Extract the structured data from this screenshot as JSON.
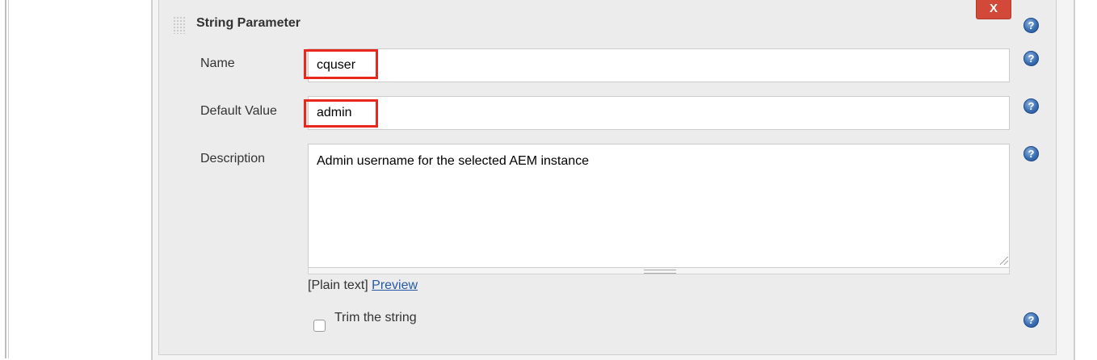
{
  "section": {
    "title": "String Parameter",
    "delete_label": "X",
    "help_glyph": "?"
  },
  "fields": {
    "name": {
      "label": "Name",
      "value": "cquser"
    },
    "default_value": {
      "label": "Default Value",
      "value": "admin"
    },
    "description": {
      "label": "Description",
      "value": "Admin username for the selected AEM instance"
    }
  },
  "format": {
    "plain_text": "[Plain text]",
    "preview_link": "Preview"
  },
  "trim": {
    "label": "Trim the string",
    "checked": false
  },
  "colors": {
    "delete_button": "#d24939",
    "highlight_box": "#e8281c",
    "help_icon": "#3a6fb5",
    "link": "#2559a7"
  },
  "icons": {
    "help": "question-circle-icon",
    "drag": "drag-handle-icon",
    "resize": "resize-grip-icon"
  }
}
